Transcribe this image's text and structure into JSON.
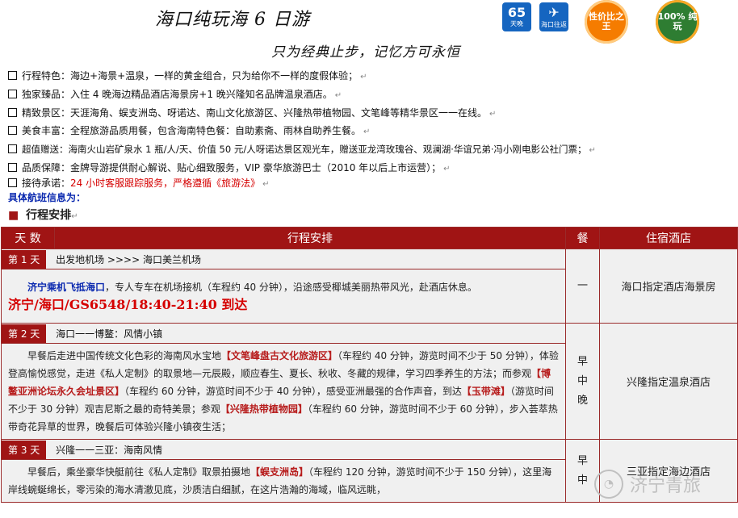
{
  "header": {
    "title": "海口纯玩海 6 日游",
    "subtitle": "只为经典止步，记忆方可永恒",
    "badges": [
      {
        "top": "6",
        "bottom": "5",
        "caption": "天晚"
      },
      {
        "caption": "海口往返"
      }
    ],
    "seals": [
      {
        "label": "性价比之王",
        "color": "#f57c00"
      },
      {
        "label": "100% 纯玩",
        "color": "#2e7d32"
      }
    ]
  },
  "features": [
    {
      "label": "行程特色：",
      "text": "海边+海景+温泉，一样的黄金组合，只为给你不一样的度假体验；"
    },
    {
      "label": "独家臻品：",
      "text": "入住 4 晚海边精品酒店海景房+1 晚兴隆知名品牌温泉酒店。"
    },
    {
      "label": "精致景区：",
      "text": "天涯海角、蜈支洲岛、呀诺达、南山文化旅游区、兴隆热带植物园、文笔峰等精华景区一一在线。"
    },
    {
      "label": "美食丰富：",
      "text": "全程旅游品质用餐，包含海南特色餐：自助素斋、雨林自助养生餐。"
    },
    {
      "label": "超值赠送：",
      "text": "海南火山岩矿泉水 1 瓶/人/天、价值 50 元/人呀诺达景区观光车，赠送亚龙湾玫瑰谷、观澜湖·华谊兄弟·冯小刚电影公社门票；"
    },
    {
      "label": "品质保障：",
      "text": "金牌导游提供耐心解说、贴心细致服务，VIP 豪华旅游巴士（2010 年以后上市运营）；"
    },
    {
      "label": "接待承诺：",
      "text": "24 小时客服跟踪服务，严格遵循《旅游法》"
    }
  ],
  "flight_info_label": "具体航班信息为：",
  "section_heading": "行程安排",
  "table": {
    "headers": [
      "天 数",
      "行程安排",
      "餐",
      "住宿酒店"
    ],
    "days": [
      {
        "tag": "第 1 天",
        "title": "出发地机场 >>>> 海口美兰机场",
        "body_lead": "济宁乘机飞抵海口",
        "body": "，专人专车在机场接机（车程约 40 分钟），沿途感受椰城美丽热带风光，赴酒店休息。",
        "flight": "济宁/海口/GS6548/18:40-21:40 到达",
        "meal": "一",
        "hotel": "海口指定酒店海景房"
      },
      {
        "tag": "第 2 天",
        "title": "海口一一博鳌：风情小镇",
        "meal_lines": [
          "早",
          "中",
          "晚"
        ],
        "hotel": "兴隆指定温泉酒店",
        "segments": [
          {
            "t": "早餐后走进中国传统文化色彩的海南风水宝地"
          },
          {
            "t": "【文笔峰盘古文化旅游区】",
            "hl": true
          },
          {
            "t": "（车程约 40 分钟，游览时间不少于 50 分钟），体验登高愉悦感觉，走进《私人定制》的取景地—元辰殿，顺应春生、夏长、秋收、冬藏的规律，学习四季养生的方法；而参观"
          },
          {
            "t": "【博鳌亚洲论坛永久会址景区】",
            "hl": true
          },
          {
            "t": "（车程约 60 分钟，游览时间不少于 40 分钟），感受亚洲最强的合作声音，到达"
          },
          {
            "t": "【玉带滩】",
            "hl": true
          },
          {
            "t": "（游览时间不少于 30 分钟）观吉尼斯之最的奇特美景；参观"
          },
          {
            "t": "【兴隆热带植物园】",
            "hl": true
          },
          {
            "t": "（车程约 60 分钟，游览时间不少于 60 分钟），步入荟萃热带奇花异草的世界，晚餐后可体验兴隆小镇夜生活；"
          }
        ]
      },
      {
        "tag": "第 3 天",
        "title": "兴隆一一三亚：海南风情",
        "meal_lines": [
          "早",
          "中"
        ],
        "hotel": "三亚指定海边酒店",
        "segments": [
          {
            "t": "早餐后，乘坐豪华快艇前往《私人定制》取景拍摄地"
          },
          {
            "t": "【蜈支洲岛】",
            "hl": true
          },
          {
            "t": "（车程约 120 分钟，游览时间不少于 150 分钟），这里海岸线蜿蜒绵长，零污染的海水清澈见底，沙质洁白细腻，在这片浩瀚的海域，临风远眺，"
          }
        ]
      }
    ]
  },
  "watermark": "济宁青旅"
}
